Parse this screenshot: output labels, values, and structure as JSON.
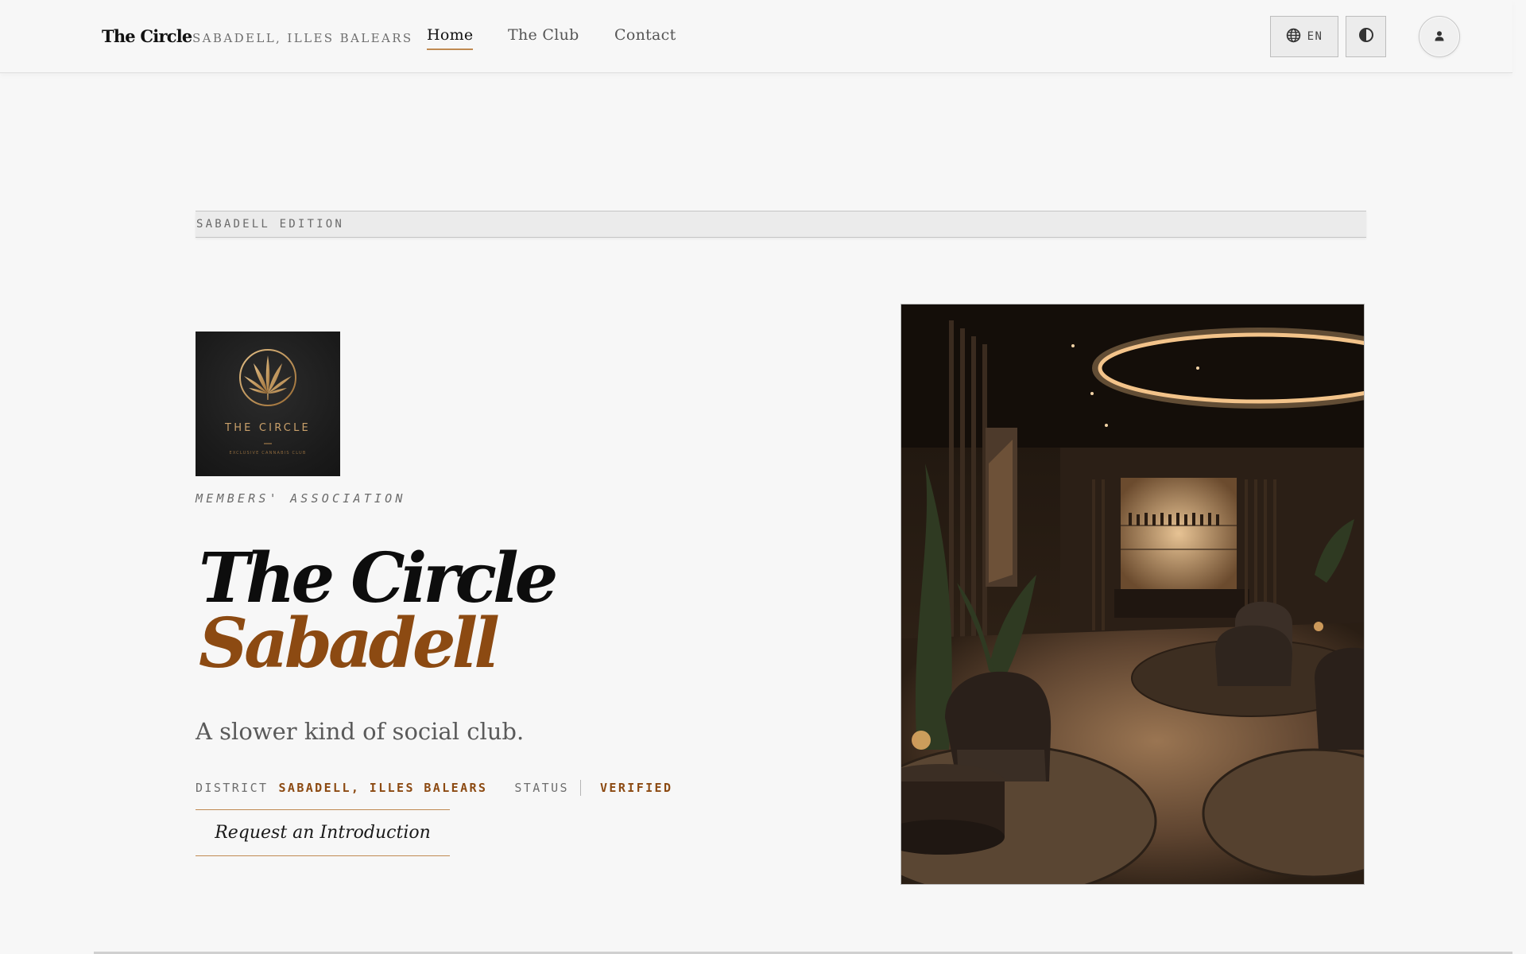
{
  "header": {
    "brand": "The Circle",
    "brand_sub": "SABADELL, ILLES BALEARS",
    "nav": [
      {
        "label": "Home",
        "active": true
      },
      {
        "label": "The Club",
        "active": false
      },
      {
        "label": "Contact",
        "active": false
      }
    ],
    "language": "EN",
    "icons": {
      "language": "globe-icon",
      "theme": "contrast-icon",
      "account": "user-icon"
    }
  },
  "hero": {
    "edition": "SABADELL EDITION",
    "logo_text": "THE CIRCLE",
    "logo_subtext": "EXCLUSIVE CANNABIS CLUB",
    "eyebrow": "MEMBERS' ASSOCIATION",
    "title_line1": "The Circle",
    "title_line2": "Sabadell",
    "tagline": "A slower kind of social club.",
    "meta": {
      "district_label": "DISTRICT",
      "district_value": "SABADELL, ILLES BALEARS",
      "status_label": "STATUS",
      "status_value": "VERIFIED"
    },
    "cta": "Request an Introduction"
  },
  "colors": {
    "accent": "#8c4a12",
    "underline": "#c08a52",
    "background": "#f7f7f7"
  }
}
